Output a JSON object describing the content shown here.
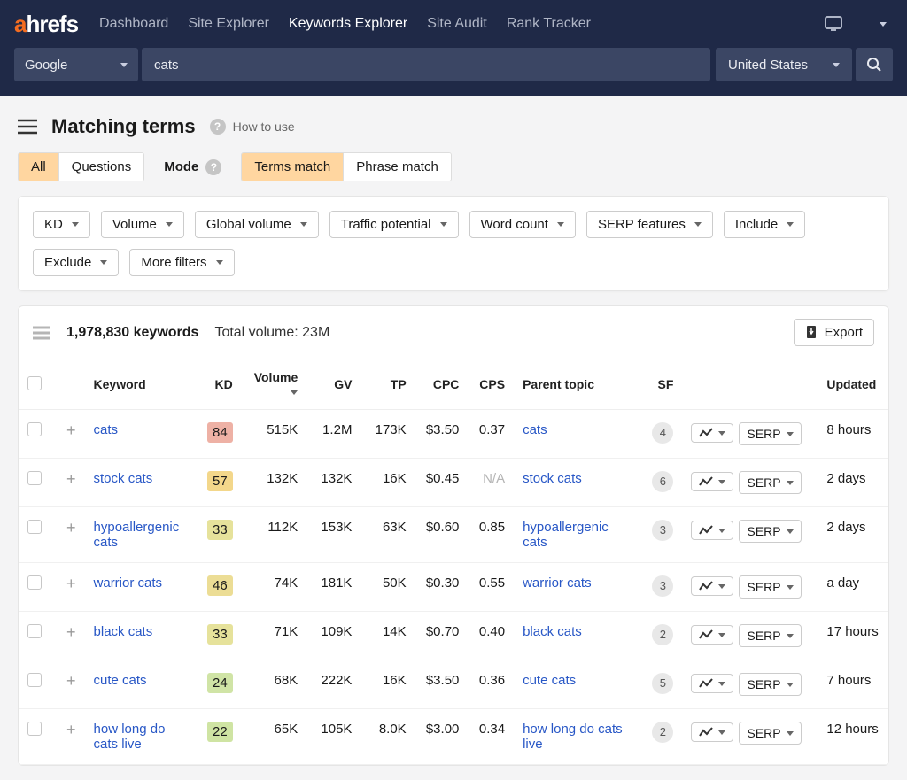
{
  "nav": {
    "logo_a": "a",
    "logo_rest": "hrefs",
    "items": [
      "Dashboard",
      "Site Explorer",
      "Keywords Explorer",
      "Site Audit",
      "Rank Tracker"
    ],
    "active_index": 2
  },
  "search": {
    "engine": "Google",
    "query": "cats",
    "country": "United States"
  },
  "page": {
    "title": "Matching terms",
    "how_to_use": "How to use"
  },
  "tabs": {
    "scope": [
      "All",
      "Questions"
    ],
    "scope_active": 0,
    "mode_label": "Mode",
    "mode": [
      "Terms match",
      "Phrase match"
    ],
    "mode_active": 0
  },
  "filters": [
    "KD",
    "Volume",
    "Global volume",
    "Traffic potential",
    "Word count",
    "SERP features",
    "Include",
    "Exclude",
    "More filters"
  ],
  "summary": {
    "count_label": "1,978,830 keywords",
    "total_volume": "Total volume: 23M",
    "export": "Export"
  },
  "columns": {
    "keyword": "Keyword",
    "kd": "KD",
    "volume": "Volume",
    "gv": "GV",
    "tp": "TP",
    "cpc": "CPC",
    "cps": "CPS",
    "parent": "Parent topic",
    "sf": "SF",
    "updated": "Updated"
  },
  "serp_label": "SERP",
  "rows": [
    {
      "keyword": "cats",
      "kd": "84",
      "kd_bg": "#eeb1a5",
      "volume": "515K",
      "gv": "1.2M",
      "tp": "173K",
      "cpc": "$3.50",
      "cps": "0.37",
      "parent": "cats",
      "sf": "4",
      "updated": "8 hours"
    },
    {
      "keyword": "stock cats",
      "kd": "57",
      "kd_bg": "#f3d78b",
      "volume": "132K",
      "gv": "132K",
      "tp": "16K",
      "cpc": "$0.45",
      "cps": "N/A",
      "cps_muted": true,
      "parent": "stock cats",
      "sf": "6",
      "updated": "2 days"
    },
    {
      "keyword": "hypoallergenic cats",
      "kd": "33",
      "kd_bg": "#e6e29b",
      "volume": "112K",
      "gv": "153K",
      "tp": "63K",
      "cpc": "$0.60",
      "cps": "0.85",
      "parent": "hypoallergenic cats",
      "sf": "3",
      "updated": "2 days"
    },
    {
      "keyword": "warrior cats",
      "kd": "46",
      "kd_bg": "#ecdd95",
      "volume": "74K",
      "gv": "181K",
      "tp": "50K",
      "cpc": "$0.30",
      "cps": "0.55",
      "parent": "warrior cats",
      "sf": "3",
      "updated": "a day"
    },
    {
      "keyword": "black cats",
      "kd": "33",
      "kd_bg": "#e6e29b",
      "volume": "71K",
      "gv": "109K",
      "tp": "14K",
      "cpc": "$0.70",
      "cps": "0.40",
      "parent": "black cats",
      "sf": "2",
      "updated": "17 hours"
    },
    {
      "keyword": "cute cats",
      "kd": "24",
      "kd_bg": "#d0e4a6",
      "volume": "68K",
      "gv": "222K",
      "tp": "16K",
      "cpc": "$3.50",
      "cps": "0.36",
      "parent": "cute cats",
      "sf": "5",
      "updated": "7 hours"
    },
    {
      "keyword": "how long do cats live",
      "kd": "22",
      "kd_bg": "#cfe4a3",
      "volume": "65K",
      "gv": "105K",
      "tp": "8.0K",
      "cpc": "$3.00",
      "cps": "0.34",
      "parent": "how long do cats live",
      "sf": "2",
      "updated": "12 hours"
    }
  ]
}
